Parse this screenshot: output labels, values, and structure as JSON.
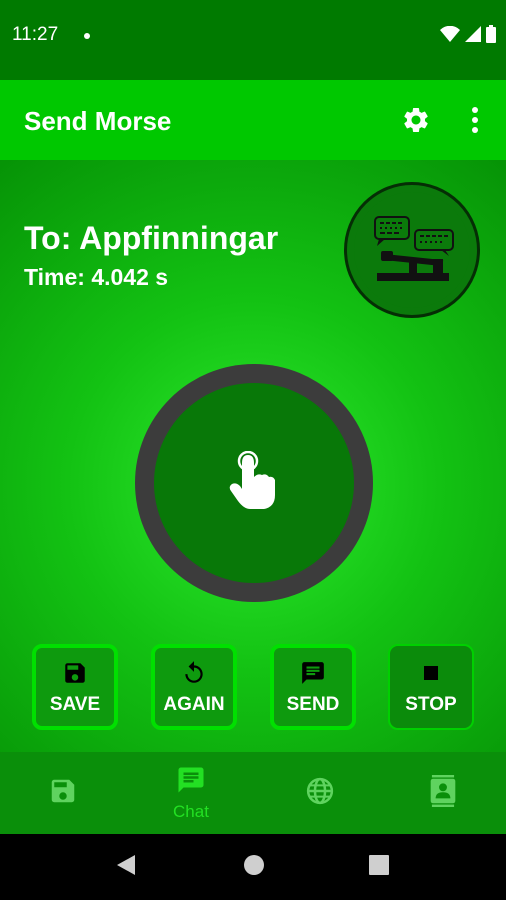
{
  "status_bar": {
    "time": "11:27"
  },
  "app_bar": {
    "title": "Send Morse",
    "settings_icon": "gear-icon",
    "more_icon": "more-vert-icon"
  },
  "main": {
    "recipient": "To: Appfinningar",
    "time_label": "Time: 4.042 s"
  },
  "actions": [
    {
      "label": "SAVE",
      "icon": "save-icon"
    },
    {
      "label": "AGAIN",
      "icon": "replay-icon"
    },
    {
      "label": "SEND",
      "icon": "message-icon"
    },
    {
      "label": "STOP",
      "icon": "stop-icon"
    }
  ],
  "bottom_nav": [
    {
      "label": "",
      "icon": "save-icon"
    },
    {
      "label": "Chat",
      "icon": "chat-icon",
      "active": true
    },
    {
      "label": "",
      "icon": "globe-icon"
    },
    {
      "label": "",
      "icon": "contact-icon"
    }
  ],
  "colors": {
    "status_bar": "#007a00",
    "app_bar": "#00c800",
    "accent": "#00e000",
    "active_nav": "#23e023"
  }
}
